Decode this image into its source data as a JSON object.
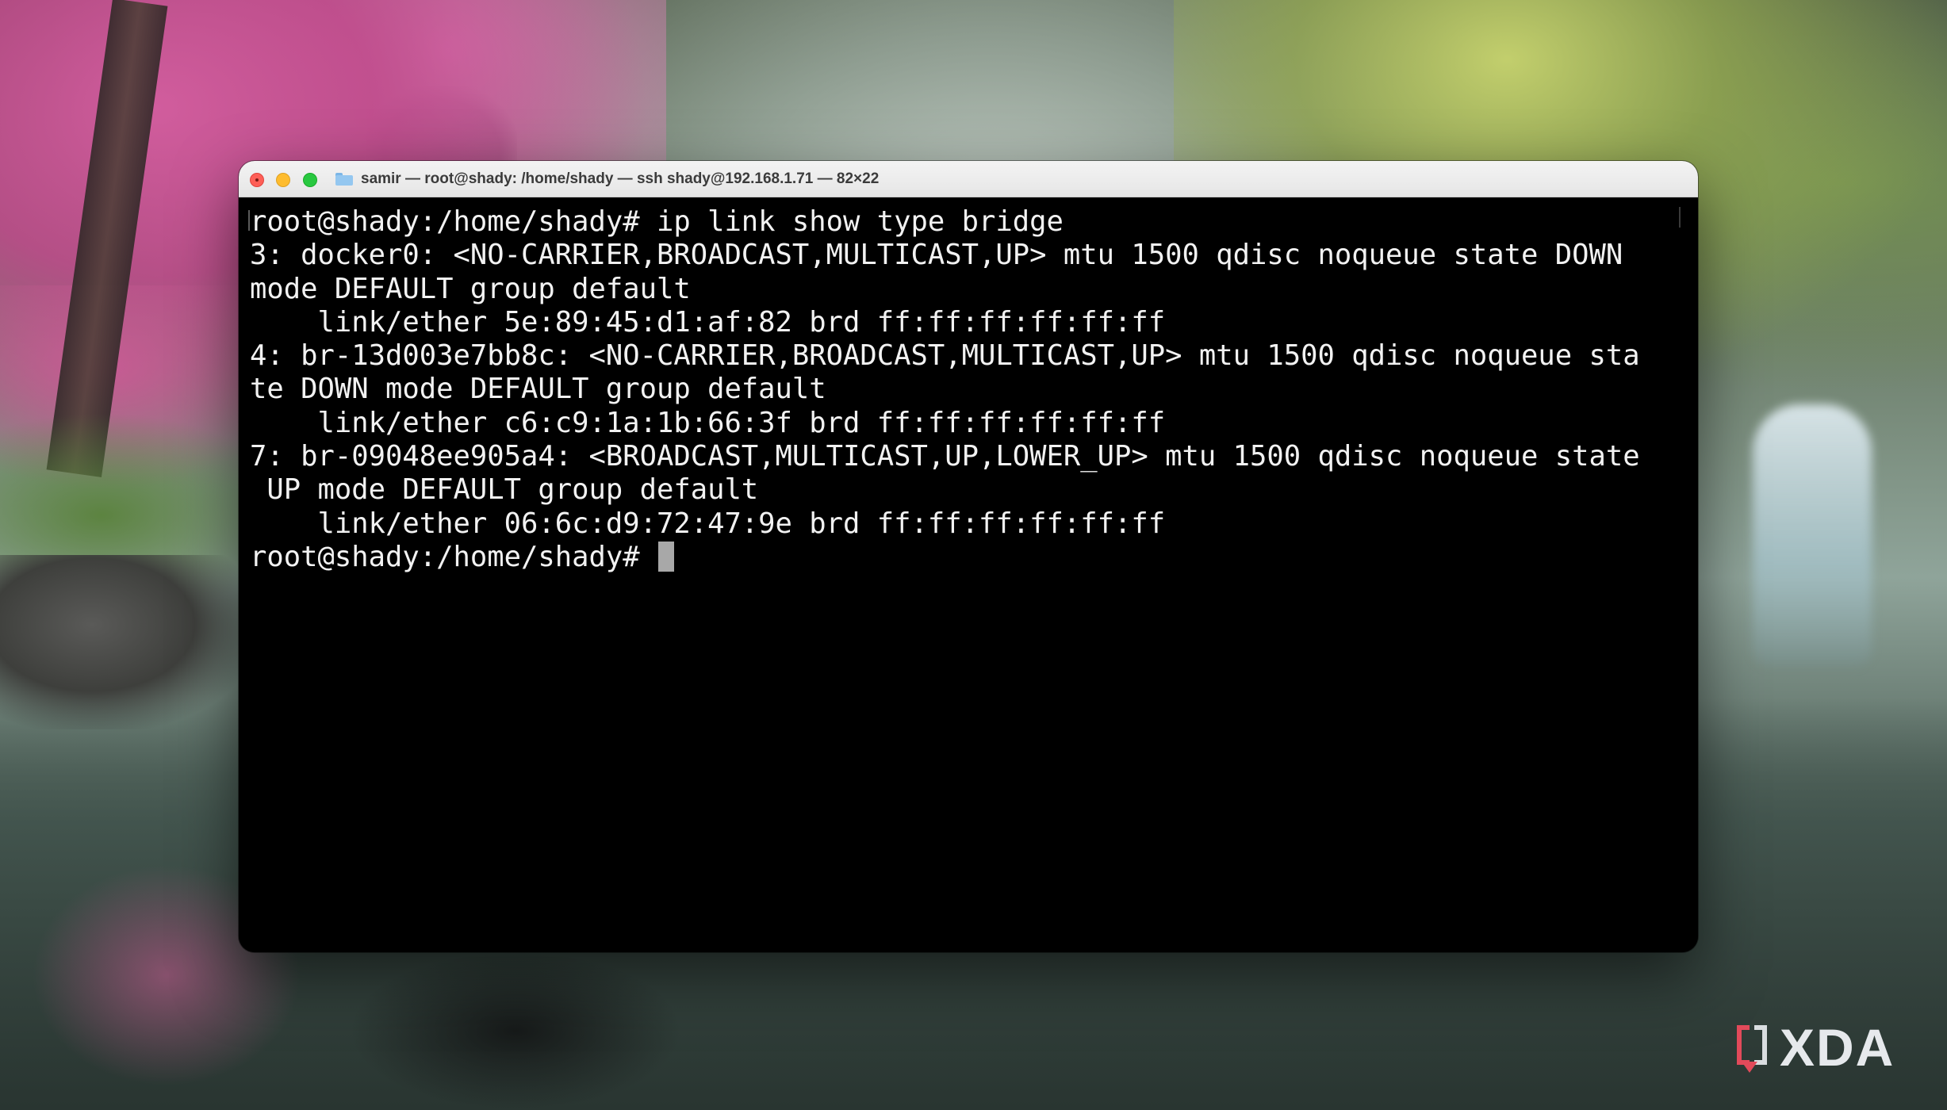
{
  "window": {
    "title": "samir — root@shady: /home/shady — ssh shady@192.168.1.71 — 82×22",
    "icon": "folder-icon"
  },
  "terminal": {
    "lines": [
      "root@shady:/home/shady# ip link show type bridge",
      "3: docker0: <NO-CARRIER,BROADCAST,MULTICAST,UP> mtu 1500 qdisc noqueue state DOWN",
      "mode DEFAULT group default",
      "    link/ether 5e:89:45:d1:af:82 brd ff:ff:ff:ff:ff:ff",
      "4: br-13d003e7bb8c: <NO-CARRIER,BROADCAST,MULTICAST,UP> mtu 1500 qdisc noqueue sta",
      "te DOWN mode DEFAULT group default",
      "    link/ether c6:c9:1a:1b:66:3f brd ff:ff:ff:ff:ff:ff",
      "7: br-09048ee905a4: <BROADCAST,MULTICAST,UP,LOWER_UP> mtu 1500 qdisc noqueue state",
      " UP mode DEFAULT group default",
      "    link/ether 06:6c:d9:72:47:9e brd ff:ff:ff:ff:ff:ff"
    ],
    "prompt": "root@shady:/home/shady# "
  },
  "watermark": {
    "text": "XDA"
  },
  "colors": {
    "terminal_bg": "#000000",
    "terminal_fg": "#f2f2f2",
    "close": "#fe5f57",
    "minimize": "#febc2e",
    "maximize": "#28c840"
  }
}
